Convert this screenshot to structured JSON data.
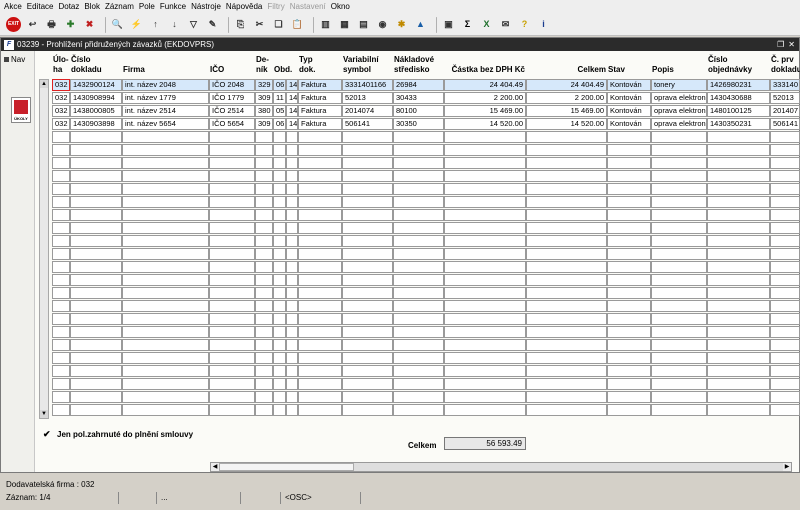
{
  "menu": [
    {
      "label": "Akce",
      "disabled": false
    },
    {
      "label": "Editace",
      "disabled": false
    },
    {
      "label": "Dotaz",
      "disabled": false
    },
    {
      "label": "Blok",
      "disabled": false
    },
    {
      "label": "Záznam",
      "disabled": false
    },
    {
      "label": "Pole",
      "disabled": false
    },
    {
      "label": "Funkce",
      "disabled": false
    },
    {
      "label": "Nástroje",
      "disabled": false
    },
    {
      "label": "Nápověda",
      "disabled": false
    },
    {
      "label": "Filtry",
      "disabled": true
    },
    {
      "label": "Nastavení",
      "disabled": true
    },
    {
      "label": "Okno",
      "disabled": false
    }
  ],
  "toolbar": {
    "exit_label": "EXIT",
    "icons": [
      "save-icon",
      "print-icon",
      "new-icon",
      "delete-icon",
      "find-icon",
      "execute-icon",
      "sort-asc-icon",
      "sort-desc-icon",
      "filter-icon",
      "edit-icon",
      "attach-icon",
      "cut-icon",
      "copy-icon",
      "paste-icon",
      "columns-icon",
      "chart-icon",
      "calendar-icon",
      "globe-icon",
      "star-icon",
      "warning-icon",
      "report-icon",
      "sum-icon",
      "excel-icon",
      "email-icon",
      "help-icon",
      "info-icon"
    ]
  },
  "window": {
    "title": "03239 - Prohlížení přidružených závazků (EKDOVPRS)",
    "logo": "F",
    "nav_label": "Nav",
    "ukoly_label": "ÚKOLY"
  },
  "columns": [
    {
      "key": "uloha",
      "label": "Úlo-\nha"
    },
    {
      "key": "cislo",
      "label": "Číslo\ndokladu"
    },
    {
      "key": "firma",
      "label": "Firma"
    },
    {
      "key": "ico",
      "label": "IČO"
    },
    {
      "key": "denik",
      "label": "De-\nník"
    },
    {
      "key": "obd",
      "label": "Obd."
    },
    {
      "key": "x",
      "label": ""
    },
    {
      "key": "typ",
      "label": "Typ\ndok."
    },
    {
      "key": "vs",
      "label": "Variabilní\nsymbol"
    },
    {
      "key": "ns",
      "label": "Nákladové\nstředisko"
    },
    {
      "key": "castka",
      "label": "Částka bez DPH Kč"
    },
    {
      "key": "celkem",
      "label": "Celkem"
    },
    {
      "key": "stav",
      "label": "Stav"
    },
    {
      "key": "popis",
      "label": "Popis"
    },
    {
      "key": "objednavka",
      "label": "Číslo\nobjednávky"
    },
    {
      "key": "cprv",
      "label": "Č. prv\ndokladu"
    }
  ],
  "rows": [
    {
      "uloha": "032",
      "cislo": "1432900124",
      "firma": "int. název 2048",
      "ico": "IČO 2048",
      "denik": "329",
      "obd": "06",
      "x": "14",
      "typ": "Faktura",
      "vs": "3331401166",
      "ns": "26984",
      "castka": "24 404.49",
      "celkem": "24 404.49",
      "stav": "Kontován",
      "popis": "tonery",
      "objednavka": "1426980231",
      "cprv": "333140"
    },
    {
      "uloha": "032",
      "cislo": "1430908994",
      "firma": "int. název 1779",
      "ico": "IČO 1779",
      "denik": "309",
      "obd": "11",
      "x": "14",
      "typ": "Faktura",
      "vs": "52013",
      "ns": "30433",
      "castka": "2 200.00",
      "celkem": "2 200.00",
      "stav": "Kontován",
      "popis": "oprava elektron",
      "objednavka": "1430430688",
      "cprv": "52013"
    },
    {
      "uloha": "032",
      "cislo": "1438000805",
      "firma": "int. název 2514",
      "ico": "IČO 2514",
      "denik": "380",
      "obd": "05",
      "x": "14",
      "typ": "Faktura",
      "vs": "2014074",
      "ns": "80100",
      "castka": "15 469.00",
      "celkem": "15 469.00",
      "stav": "Kontován",
      "popis": "oprava elektron",
      "objednavka": "1480100125",
      "cprv": "201407"
    },
    {
      "uloha": "032",
      "cislo": "1430903898",
      "firma": "int. název 5654",
      "ico": "IČO 5654",
      "denik": "309",
      "obd": "06",
      "x": "14",
      "typ": "Faktura",
      "vs": "506141",
      "ns": "30350",
      "castka": "14 520.00",
      "celkem": "14 520.00",
      "stav": "Kontován",
      "popis": "oprava elektron",
      "objednavka": "1430350231",
      "cprv": "506141"
    }
  ],
  "empty_row_count": 22,
  "footer": {
    "checkbox_label": "Jen pol.zahrnuté do plnění smlouvy",
    "checkbox_checked": "✔",
    "total_label": "Celkem",
    "total_value": "56 593.49"
  },
  "status": {
    "line1": "Dodavatelská firma : 032",
    "record": "Záznam: 1/4",
    "dots": "...",
    "mode": "<OSC>"
  }
}
